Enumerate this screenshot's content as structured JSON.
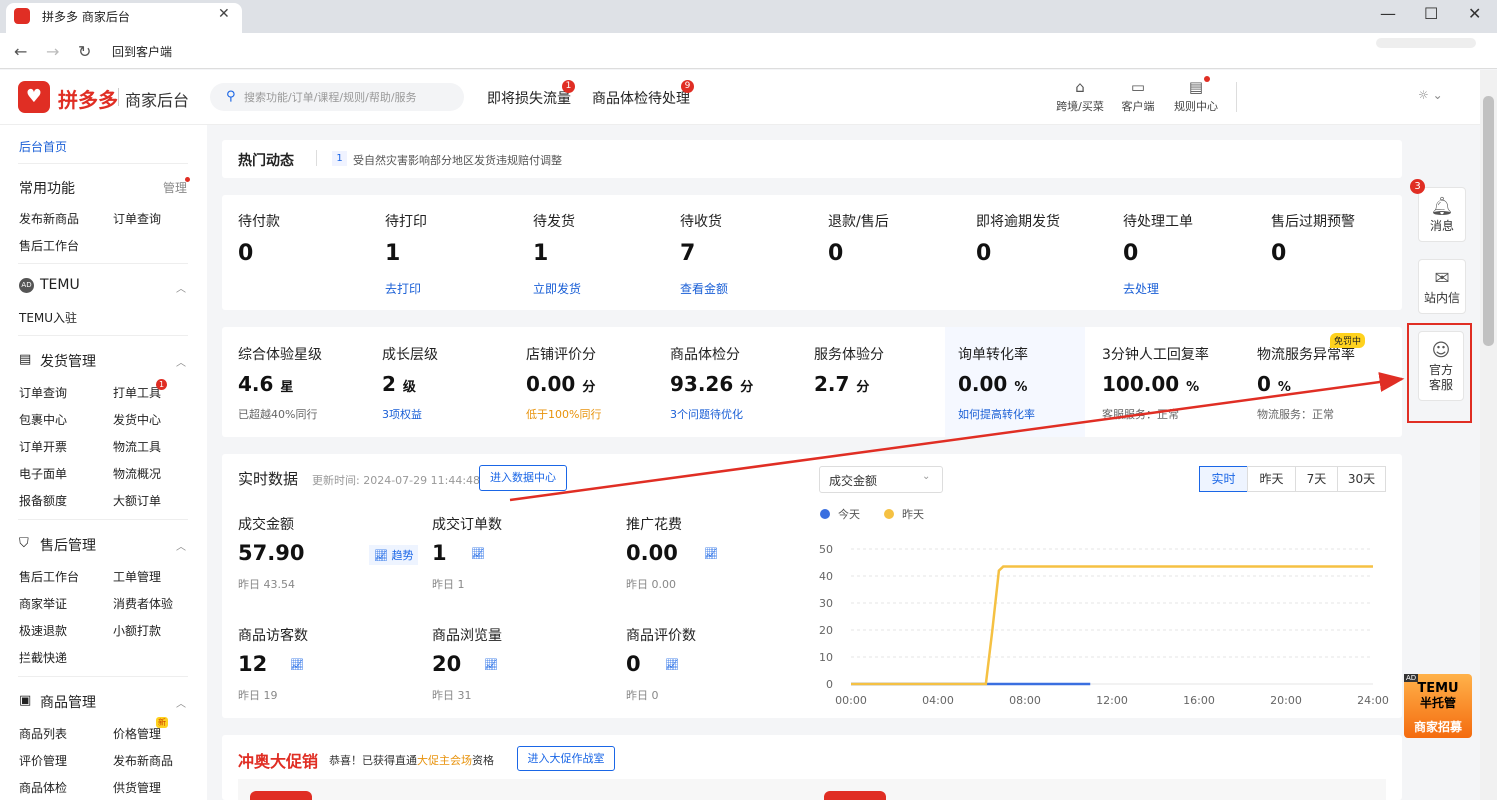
{
  "browser": {
    "tab_title": "拼多多 商家后台",
    "back_label": "回到客户端",
    "minimize": "—",
    "maximize": "☐",
    "close": "✕"
  },
  "header": {
    "logo_text": "拼多多",
    "logo_sub": "商家后台",
    "search_placeholder": "搜索功能/订单/课程/规则/帮助/服务",
    "nav": [
      {
        "label": "即将损失流量",
        "badge": "1"
      },
      {
        "label": "商品体检待处理",
        "badge": "9"
      }
    ],
    "tools": [
      "跨境/买菜",
      "客户端",
      "规则中心"
    ]
  },
  "sidebar": {
    "home": "后台首页",
    "common": {
      "title": "常用功能",
      "manage": "管理",
      "items": [
        "发布新商品",
        "订单查询",
        "售后工作台"
      ]
    },
    "temu": {
      "icon": "AD",
      "title": "TEMU",
      "items": [
        "TEMU入驻"
      ]
    },
    "shipping": {
      "title": "发货管理",
      "items": [
        "订单查询",
        "打单工具",
        "包裹中心",
        "发货中心",
        "订单开票",
        "物流工具",
        "电子面单",
        "物流概况",
        "报备额度",
        "大额订单"
      ],
      "badge": "1"
    },
    "aftersale": {
      "title": "售后管理",
      "items": [
        "售后工作台",
        "工单管理",
        "商家举证",
        "消费者体验",
        "极速退款",
        "小额打款",
        "拦截快递"
      ]
    },
    "goods": {
      "title": "商品管理",
      "items": [
        "商品列表",
        "价格管理",
        "评价管理",
        "发布新商品",
        "商品体检",
        "供货管理"
      ],
      "new_badge": "新"
    }
  },
  "hot": {
    "title": "热门动态",
    "num": "1",
    "text": "受自然灾害影响部分地区发货违规赔付调整"
  },
  "orders": [
    {
      "label": "待付款",
      "value": "0",
      "link": ""
    },
    {
      "label": "待打印",
      "value": "1",
      "link": "去打印"
    },
    {
      "label": "待发货",
      "value": "1",
      "link": "立即发货"
    },
    {
      "label": "待收货",
      "value": "7",
      "link": "查看金额"
    },
    {
      "label": "退款/售后",
      "value": "0",
      "link": ""
    },
    {
      "label": "即将逾期发货",
      "value": "0",
      "link": ""
    },
    {
      "label": "待处理工单",
      "value": "0",
      "link": "去处理"
    },
    {
      "label": "售后过期预警",
      "value": "0",
      "link": ""
    }
  ],
  "metrics": [
    {
      "label": "综合体验星级",
      "value": "4.6",
      "unit": "星",
      "sub": "已超越40%同行"
    },
    {
      "label": "成长层级",
      "value": "2",
      "unit": "级",
      "sub": "3项权益"
    },
    {
      "label": "店铺评价分",
      "value": "0.00",
      "unit": "分",
      "sub": "低于100%同行"
    },
    {
      "label": "商品体检分",
      "value": "93.26",
      "unit": "分",
      "sub": "3个问题待优化"
    },
    {
      "label": "服务体验分",
      "value": "2.7",
      "unit": "分",
      "sub": ""
    },
    {
      "label": "询单转化率",
      "value": "0.00",
      "unit": "%",
      "sub": "如何提高转化率"
    },
    {
      "label": "3分钟人工回复率",
      "value": "100.00",
      "unit": "%",
      "sub": "客服服务：正常"
    },
    {
      "label": "物流服务异常率",
      "value": "0",
      "unit": "%",
      "sub": "物流服务：正常",
      "tag": "免罚中"
    }
  ],
  "realtime": {
    "title": "实时数据",
    "updated": "更新时间: 2024-07-29 11:44:48",
    "enter_btn": "进入数据中心",
    "stats": [
      {
        "label": "成交金额",
        "value": "57.90",
        "trend": "趋势",
        "yesterday": "昨日 43.54"
      },
      {
        "label": "成交订单数",
        "value": "1",
        "yesterday": "昨日 1"
      },
      {
        "label": "推广花费",
        "value": "0.00",
        "yesterday": "昨日 0.00"
      },
      {
        "label": "商品访客数",
        "value": "12",
        "yesterday": "昨日 19"
      },
      {
        "label": "商品浏览量",
        "value": "20",
        "yesterday": "昨日 31"
      },
      {
        "label": "商品评价数",
        "value": "0",
        "yesterday": "昨日 0"
      }
    ],
    "select_value": "成交金额",
    "ranges": [
      "实时",
      "昨天",
      "7天",
      "30天"
    ]
  },
  "chart_data": {
    "type": "line",
    "x_ticks": [
      "00:00",
      "04:00",
      "08:00",
      "12:00",
      "16:00",
      "20:00",
      "24:00"
    ],
    "ylim": [
      0,
      50
    ],
    "y_ticks": [
      "0",
      "10",
      "20",
      "30",
      "40",
      "50"
    ],
    "grid": true,
    "legend": "top-left",
    "series": [
      {
        "name": "今天",
        "color": "#3a6fe0",
        "points": [
          [
            0,
            0
          ],
          [
            11,
            0
          ]
        ]
      },
      {
        "name": "昨天",
        "color": "#f5c143",
        "points": [
          [
            0,
            0
          ],
          [
            6.2,
            0
          ],
          [
            6.5,
            20
          ],
          [
            6.8,
            42
          ],
          [
            7,
            43.5
          ],
          [
            24,
            43.5
          ]
        ]
      }
    ]
  },
  "promo": {
    "title": "冲奥大促销",
    "text1": "恭喜！已获得直通",
    "highlight": "大促主会场",
    "text2": "资格",
    "btn": "进入大促作战室"
  },
  "float": {
    "msg": "消息",
    "msg_badge": "3",
    "mail": "站内信",
    "service": "官方客服"
  },
  "temu_ad": {
    "tag": "AD",
    "line1": "TEMU",
    "line2": "半托管",
    "line3": "商家招募"
  }
}
